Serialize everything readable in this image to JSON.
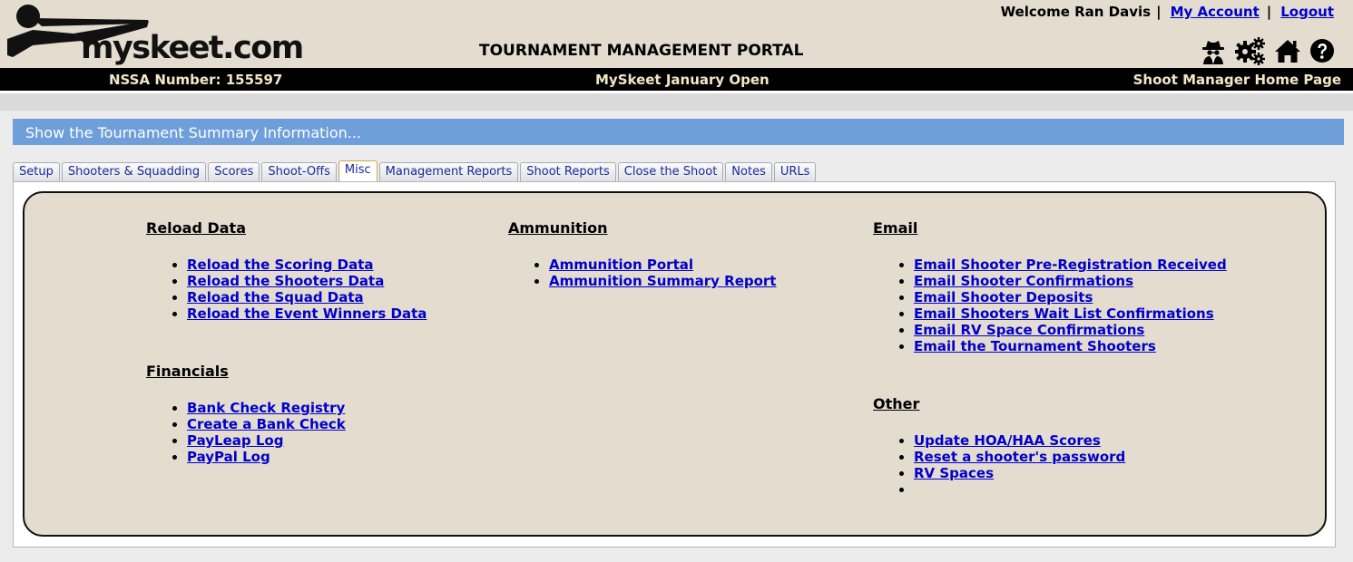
{
  "header": {
    "logo_text": "myskeet.com",
    "portal_title": "TOURNAMENT MANAGEMENT PORTAL",
    "welcome": "Welcome Ran Davis",
    "my_account": "My Account",
    "logout": "Logout",
    "separator": "|",
    "icons": [
      "spy-icon",
      "gears-icon",
      "home-icon",
      "help-icon"
    ]
  },
  "infobar": {
    "nssa": "NSSA Number: 155597",
    "shoot_name": "MySkeet January Open",
    "home_link": "Shoot Manager Home Page"
  },
  "summary": {
    "text": "Show the Tournament Summary Information..."
  },
  "tabs": [
    {
      "label": "Setup"
    },
    {
      "label": "Shooters & Squadding"
    },
    {
      "label": "Scores"
    },
    {
      "label": "Shoot-Offs"
    },
    {
      "label": "Misc",
      "active": true
    },
    {
      "label": "Management Reports"
    },
    {
      "label": "Shoot Reports"
    },
    {
      "label": "Close the Shoot"
    },
    {
      "label": "Notes"
    },
    {
      "label": "URLs"
    }
  ],
  "sections": {
    "reload": {
      "title": "Reload Data",
      "items": [
        "Reload the Scoring Data",
        "Reload the Shooters Data",
        "Reload the Squad Data",
        "Reload the Event Winners Data"
      ]
    },
    "financials": {
      "title": "Financials",
      "items": [
        "Bank Check Registry",
        "Create a Bank Check",
        "PayLeap Log",
        "PayPal Log"
      ]
    },
    "ammunition": {
      "title": "Ammunition",
      "items": [
        "Ammunition Portal",
        "Ammunition Summary Report"
      ]
    },
    "email": {
      "title": "Email",
      "items": [
        "Email Shooter Pre-Registration Received",
        "Email Shooter Confirmations",
        "Email Shooter Deposits",
        "Email Shooters Wait List Confirmations",
        "Email RV Space Confirmations",
        "Email the Tournament Shooters"
      ]
    },
    "other": {
      "title": "Other",
      "items": [
        "Update HOA/HAA Scores",
        "Reset a shooter's password",
        "RV Spaces",
        ""
      ]
    }
  },
  "colors": {
    "header_bg": "#e3dccf",
    "info_bar": "#000000",
    "info_text": "#f1e7c7",
    "summary_bar": "#6f9fdb",
    "link": "#0000cc"
  }
}
